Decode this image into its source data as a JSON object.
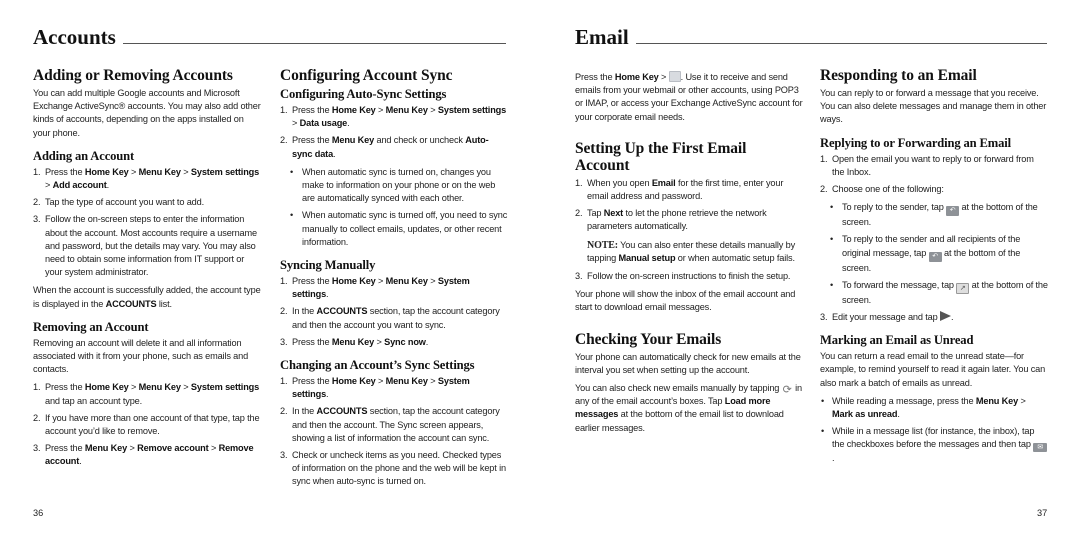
{
  "left_page": {
    "chapter_title": "Accounts",
    "page_number": "36",
    "adding_removing": {
      "title": "Adding or Removing Accounts",
      "intro": "You can add multiple Google accounts and Microsoft Exchange ActiveSync® accounts. You may also add other kinds of accounts, depending on the apps installed on your phone."
    },
    "adding": {
      "title": "Adding an Account",
      "steps": [
        {
          "num": "1.",
          "t1": "Press the ",
          "b1": "Home Key",
          "t2": " > ",
          "b2": "Menu Key",
          "t3": " > ",
          "b3": "System settings",
          "t4": " > ",
          "b4": "Add account",
          "t5": "."
        },
        {
          "num": "2.",
          "text": "Tap the type of account you want to add."
        },
        {
          "num": "3.",
          "text": "Follow the on-screen steps to enter the information about the account. Most accounts require a username and password, but the details may vary. You may also need to obtain some information from IT support or your system administrator."
        }
      ],
      "outro_pre": "When the account is successfully added, the account type is displayed in the ",
      "outro_bold": "ACCOUNTS",
      "outro_post": " list."
    },
    "removing": {
      "title": "Removing an Account",
      "intro": "Removing an account will delete it and all information associated with it from your phone, such as emails and contacts.",
      "steps": [
        {
          "num": "1.",
          "t1": "Press the ",
          "b1": "Home Key",
          "t2": " > ",
          "b2": "Menu Key",
          "t3": " > ",
          "b3": "System settings",
          "t4": " and tap an account type."
        },
        {
          "num": "2.",
          "text": "If you have more than one account of that type, tap the account you’d like to remove."
        },
        {
          "num": "3.",
          "t1": "Press the ",
          "b1": "Menu Key",
          "t2": " > ",
          "b2": "Remove account",
          "t3": " > ",
          "b3": "Remove account",
          "t4": "."
        }
      ]
    },
    "sync": {
      "title": "Configuring Account Sync",
      "auto": {
        "title": "Configuring Auto-Sync Settings",
        "step1": {
          "num": "1.",
          "t1": "Press the ",
          "b1": "Home Key",
          "t2": " > ",
          "b2": "Menu Key",
          "t3": " > ",
          "b3": "System settings",
          "t4": " > ",
          "b4": "Data usage",
          "t5": "."
        },
        "step2": {
          "num": "2.",
          "t1": "Press the ",
          "b1": "Menu Key",
          "t2": " and check or uncheck ",
          "b2": "Auto-sync data",
          "t3": "."
        },
        "bullets": [
          "When automatic sync is turned on, changes you make to information on your phone or on the web are automatically synced with each other.",
          "When automatic sync is turned off, you need to sync manually to collect emails, updates, or other recent information."
        ]
      },
      "manual": {
        "title": "Syncing Manually",
        "steps": [
          {
            "num": "1.",
            "t1": "Press the ",
            "b1": "Home Key",
            "t2": " > ",
            "b2": "Menu Key",
            "t3": " > ",
            "b3": "System settings",
            "t4": "."
          },
          {
            "num": "2.",
            "t1": "In the ",
            "b1": "ACCOUNTS",
            "t2": " section, tap the account category and then the account you want to sync."
          },
          {
            "num": "3.",
            "t1": "Press the ",
            "b1": "Menu Key",
            "t2": " > ",
            "b2": "Sync now",
            "t3": "."
          }
        ]
      },
      "change": {
        "title": "Changing an Account’s Sync Settings",
        "steps": [
          {
            "num": "1.",
            "t1": "Press the ",
            "b1": "Home Key",
            "t2": " > ",
            "b2": "Menu Key",
            "t3": " > ",
            "b3": "System settings",
            "t4": "."
          },
          {
            "num": "2.",
            "t1": "In the ",
            "b1": "ACCOUNTS",
            "t2": " section, tap the account category and then the account. The Sync screen appears, showing a list of information the account can sync."
          },
          {
            "num": "3.",
            "text": "Check or uncheck items as you need. Checked types of information on the phone and the web will be kept in sync when auto-sync is turned on."
          }
        ]
      }
    }
  },
  "right_page": {
    "chapter_title": "Email",
    "page_number": "37",
    "intro": {
      "t1": "Press the ",
      "b1": "Home Key",
      "t2": " > ",
      "icon": "email-app-icon",
      "t3": ". Use it to receive and send emails from your webmail or other accounts, using POP3 or IMAP, or access your Exchange ActiveSync account for your corporate email needs."
    },
    "setup": {
      "title": "Setting Up the First Email Account",
      "step1": {
        "num": "1.",
        "t1": "When you open ",
        "b1": "Email",
        "t2": " for the first time, enter your email address and password."
      },
      "step2": {
        "num": "2.",
        "t1": "Tap ",
        "b1": "Next",
        "t2": " to let the phone retrieve the network parameters automatically."
      },
      "note": {
        "label": "NOTE:",
        "t1": " You can also enter these details manually by tapping ",
        "b1": "Manual setup",
        "t2": " or when automatic setup fails."
      },
      "step3": {
        "num": "3.",
        "text": "Follow the on-screen instructions to finish the setup."
      },
      "outro": "Your phone will show the inbox of the email account and start to download email messages."
    },
    "checking": {
      "title": "Checking Your Emails",
      "p1": "Your phone can automatically check for new emails at the interval you set when setting up the account.",
      "p2": {
        "t1": "You can also check new emails manually by tapping ",
        "icon": "refresh-icon",
        "t2": " in any of the email account’s boxes. Tap ",
        "b1": "Load more messages",
        "t3": " at the bottom of the email list to download earlier messages."
      }
    },
    "responding": {
      "title": "Responding to an Email",
      "intro": "You can reply to or forward a message that you receive. You can also delete messages and manage them in other ways.",
      "reply": {
        "title": "Replying to or Forwarding an Email",
        "step1": {
          "num": "1.",
          "text": "Open the email you want to reply to or forward from the Inbox."
        },
        "step2": {
          "num": "2.",
          "text": "Choose one of the following:"
        },
        "bullets": [
          {
            "t1": "To reply to the sender, tap ",
            "icon": "reply-icon",
            "t2": " at the bottom of the screen."
          },
          {
            "t1": "To reply to the sender and all recipients of the original message, tap ",
            "icon": "reply-all-icon",
            "t2": " at the bottom of the screen."
          },
          {
            "t1": "To forward the message, tap ",
            "icon": "forward-icon",
            "t2": " at the bottom of the screen."
          }
        ],
        "step3": {
          "num": "3.",
          "t1": "Edit your message and tap ",
          "icon": "send-icon",
          "t2": "."
        }
      },
      "unread": {
        "title": "Marking an Email as Unread",
        "intro": "You can return a read email to the unread state—for example, to remind yourself to read it again later. You can also mark a batch of emails as unread.",
        "bullets": [
          {
            "t1": "While reading a message, press the ",
            "b1": "Menu Key",
            "t2": " > ",
            "b2": "Mark as unread",
            "t3": "."
          },
          {
            "t1": "While in a message list (for instance, the inbox), tap the checkboxes before the messages and then tap ",
            "icon": "mark-unread-icon",
            "t2": "."
          }
        ]
      }
    }
  }
}
